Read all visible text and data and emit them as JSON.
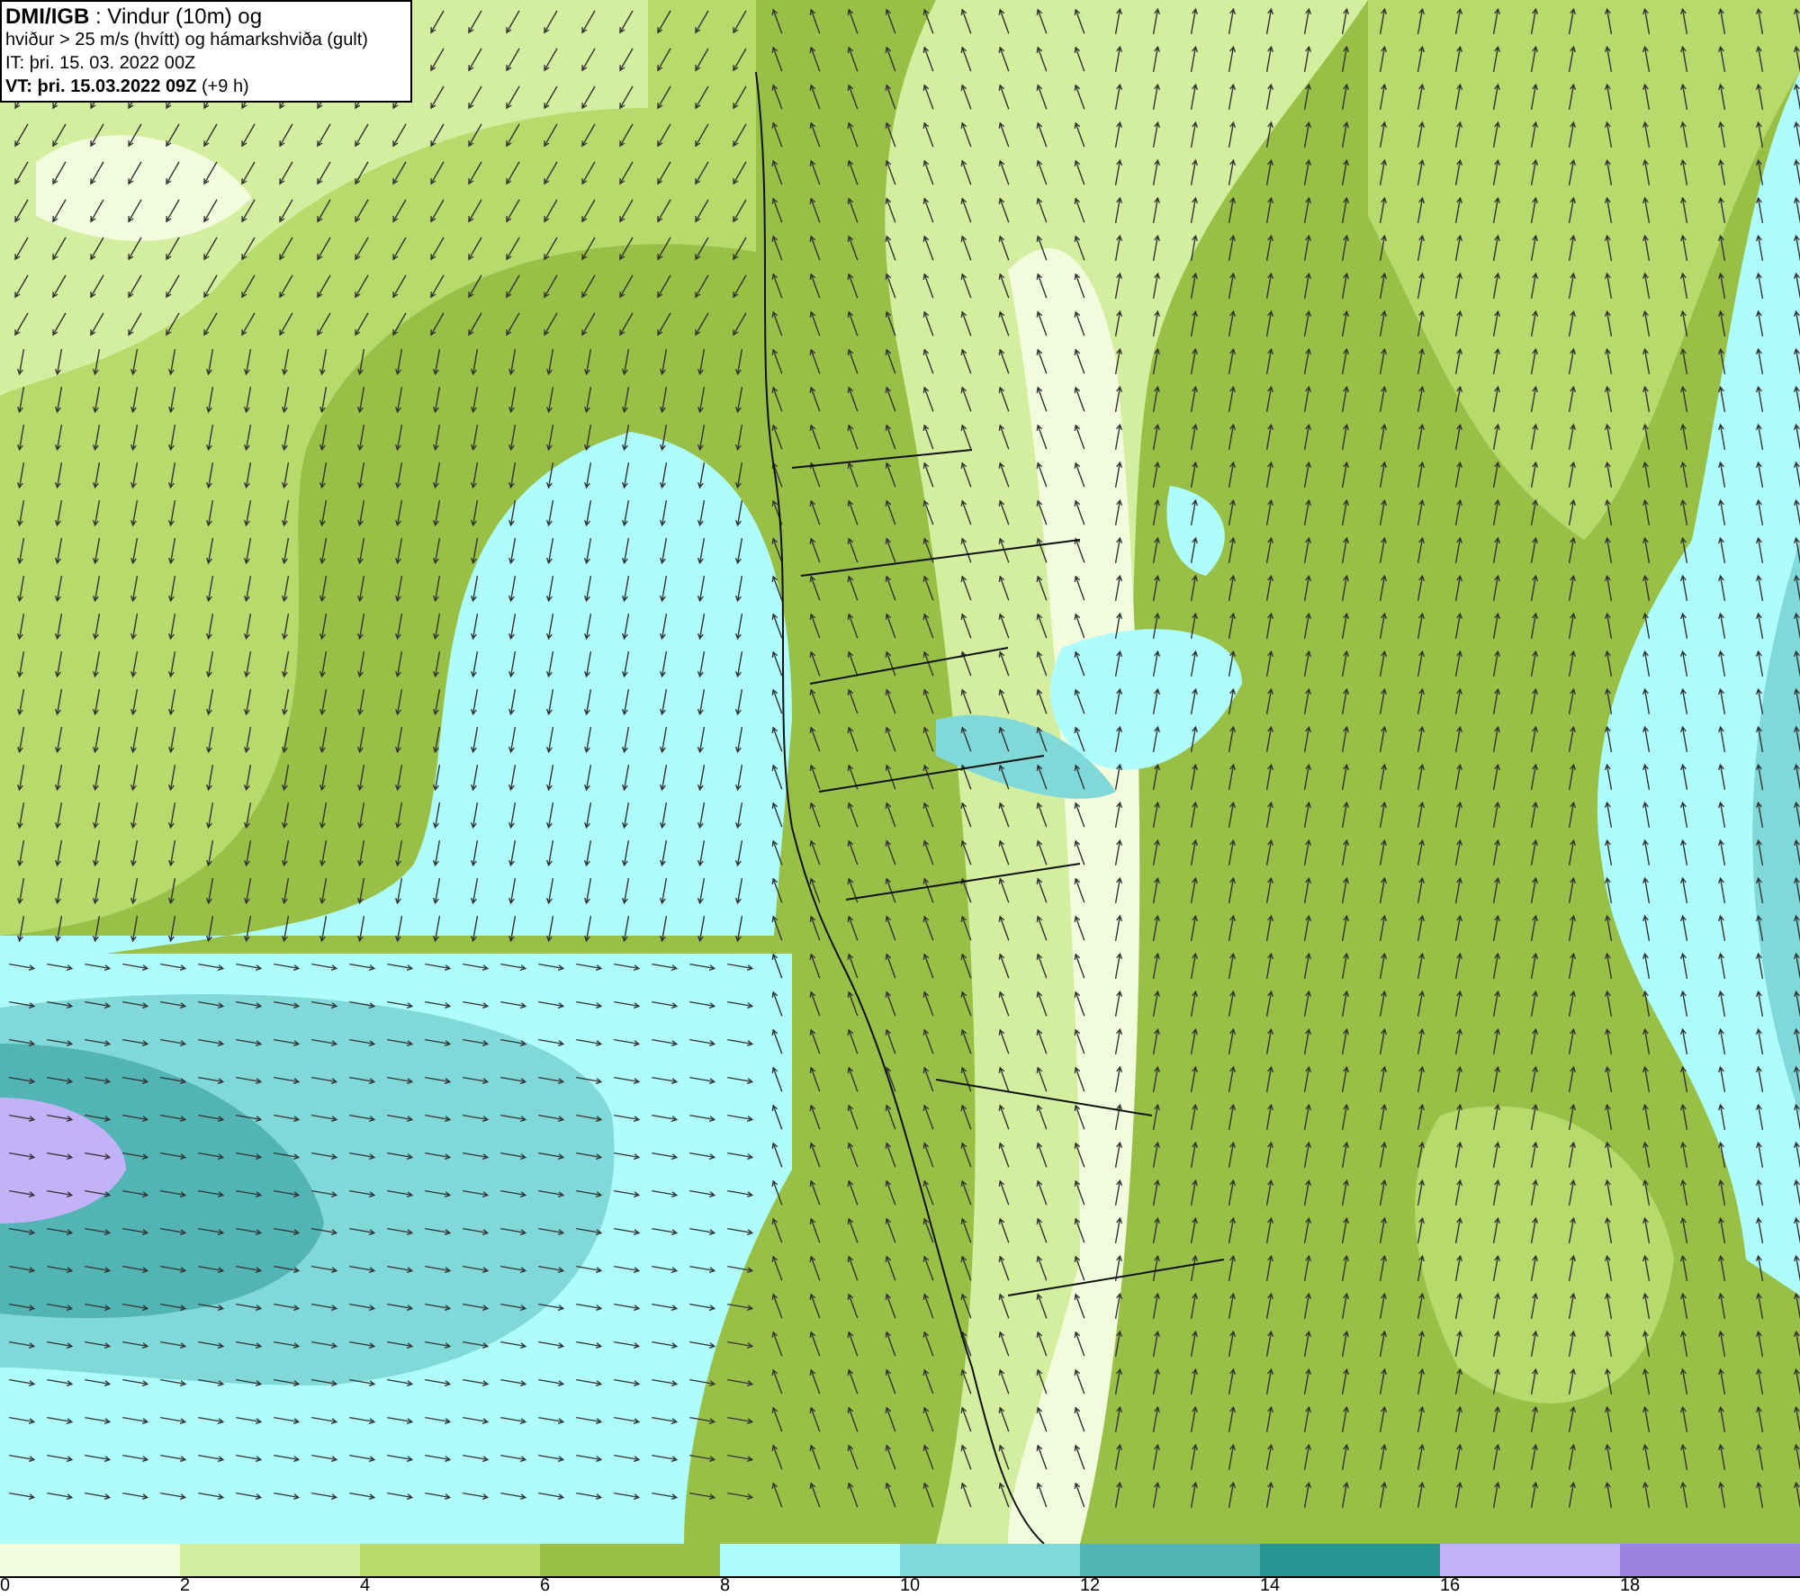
{
  "title_box": {
    "lines": [
      "**DMI/IGB** : Vindur (10m) og",
      "hviður > 25 m/s (hvítt) og hámarkshviða (gult)",
      "IT: þri. 15. 03. 2022 00Z",
      "**VT: þri. 15.03.2022 09Z** (+9 h)"
    ]
  },
  "legend": [
    {
      "label": "0",
      "color": "#f2fbdc"
    },
    {
      "label": "2",
      "color": "#d4eea0"
    },
    {
      "label": "4",
      "color": "#b6da6c"
    },
    {
      "label": "6",
      "color": "#98c046"
    },
    {
      "label": "8",
      "color": "#aefcfc"
    },
    {
      "label": "10",
      "color": "#80d8d8"
    },
    {
      "label": "12",
      "color": "#52b4b4"
    },
    {
      "label": "14",
      "color": "#259494"
    },
    {
      "label": "16",
      "color": "#c2b2f8"
    },
    {
      "label": "18",
      "color": "#9a82e0"
    }
  ]
}
